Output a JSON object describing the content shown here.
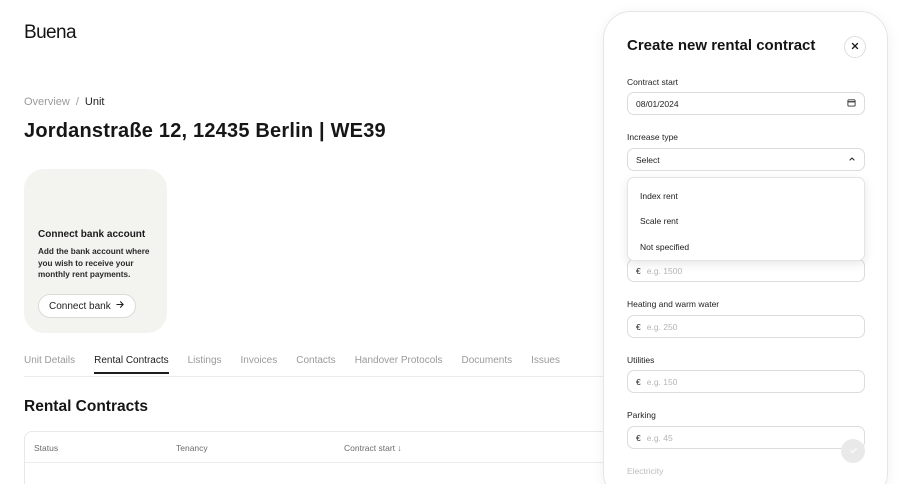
{
  "app": {
    "logo": "Buena"
  },
  "breadcrumb": {
    "items": [
      "Overview",
      "Unit"
    ],
    "separator": "/"
  },
  "page": {
    "title": "Jordanstraße 12, 12435 Berlin | WE39"
  },
  "bank_card": {
    "title": "Connect bank account",
    "description": "Add the bank account where you wish to receive your monthly rent payments.",
    "button_label": "Connect bank",
    "button_icon": "arrow-right-icon"
  },
  "tabs": [
    {
      "label": "Unit Details",
      "active": false
    },
    {
      "label": "Rental Contracts",
      "active": true
    },
    {
      "label": "Listings",
      "active": false
    },
    {
      "label": "Invoices",
      "active": false
    },
    {
      "label": "Contacts",
      "active": false
    },
    {
      "label": "Handover Protocols",
      "active": false
    },
    {
      "label": "Documents",
      "active": false
    },
    {
      "label": "Issues",
      "active": false
    }
  ],
  "section": {
    "title": "Rental Contracts"
  },
  "table": {
    "columns": [
      "Status",
      "Tenancy",
      "Contract start ↓"
    ]
  },
  "drawer": {
    "title": "Create new rental contract",
    "close_icon": "close-icon",
    "contract_start": {
      "label": "Contract start",
      "value": "08/01/2024",
      "icon": "calendar-icon"
    },
    "increase_type": {
      "label": "Increase type",
      "value": "Select",
      "icon": "chevron-up-icon",
      "options": [
        "Index rent",
        "Scale rent",
        "Not specified"
      ]
    },
    "rent": {
      "currency": "€",
      "placeholder": "e.g. 1500"
    },
    "heating": {
      "label": "Heating and warm water",
      "currency": "€",
      "placeholder": "e.g. 250"
    },
    "utilities": {
      "label": "Utilities",
      "currency": "€",
      "placeholder": "e.g. 150"
    },
    "parking": {
      "label": "Parking",
      "currency": "€",
      "placeholder": "e.g. 45"
    },
    "electricity": {
      "label": "Electricity"
    },
    "submit_icon": "check-icon"
  },
  "colors": {
    "accent": "#1d1d1d",
    "muted": "#9a9a9a",
    "card_bg": "#f3f3f0"
  }
}
